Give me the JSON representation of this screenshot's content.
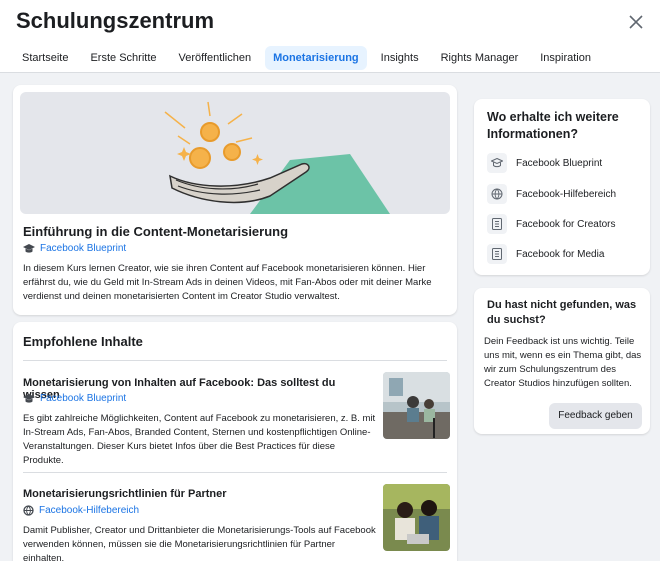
{
  "header": {
    "title": "Schulungszentrum",
    "tabs": [
      {
        "label": "Startseite"
      },
      {
        "label": "Erste Schritte"
      },
      {
        "label": "Veröffentlichen"
      },
      {
        "label": "Monetarisierung",
        "active": true
      },
      {
        "label": "Insights"
      },
      {
        "label": "Rights Manager"
      },
      {
        "label": "Inspiration"
      }
    ],
    "close_icon": "close-icon"
  },
  "course": {
    "title": "Einführung in die Content-Monetarisierung",
    "source": "Facebook Blueprint",
    "source_icon": "graduation-cap-icon",
    "description": "In diesem Kurs lernen Creator, wie sie ihren Content auf Facebook monetarisieren können. Hier erfährst du, wie du Geld mit In-Stream Ads in deinen Videos, mit Fan-Abos oder mit deiner Marke verdienst und deinen monetarisierten Content im Creator Studio verwaltest."
  },
  "recommended": {
    "heading": "Empfohlene Inhalte",
    "items": [
      {
        "title": "Monetarisierung von Inhalten auf Facebook: Das solltest du wissen",
        "source": "Facebook Blueprint",
        "source_icon": "graduation-cap-icon",
        "description": "Es gibt zahlreiche Möglichkeiten, Content auf Facebook zu monetarisieren, z. B. mit In-Stream Ads, Fan-Abos, Branded Content, Sternen und kostenpflichtigen Online-Veranstaltungen. Dieser Kurs bietet Infos über die Best Practices für diese Produkte."
      },
      {
        "title": "Monetarisierungsrichtlinien für Partner",
        "source": "Facebook-Hilfebereich",
        "source_icon": "help-center-icon",
        "description": "Damit Publisher, Creator und Drittanbieter die Monetarisierungs-Tools auf Facebook verwenden können, müssen sie die Monetarisierungsrichtlinien für Partner einhalten."
      }
    ]
  },
  "more_info": {
    "title": "Wo erhalte ich weitere Informationen?",
    "links": [
      {
        "label": "Facebook Blueprint",
        "icon": "graduation-cap-icon"
      },
      {
        "label": "Facebook-Hilfebereich",
        "icon": "globe-icon"
      },
      {
        "label": "Facebook for Creators",
        "icon": "document-icon"
      },
      {
        "label": "Facebook for Media",
        "icon": "document-icon"
      }
    ]
  },
  "feedback": {
    "title": "Du hast nicht gefunden, was du suchst?",
    "text": "Dein Feedback ist uns wichtig. Teile uns mit, wenn es ein Thema gibt, das wir zum Schulungszentrum des Creator Studios hinzufügen sollten.",
    "button": "Feedback geben"
  },
  "colors": {
    "accent": "#1b74e4",
    "active_tab_bg": "#e7f3ff",
    "page_bg": "#f0f2f5",
    "teal": "#6cc3a7",
    "coin": "#f5b24a"
  }
}
